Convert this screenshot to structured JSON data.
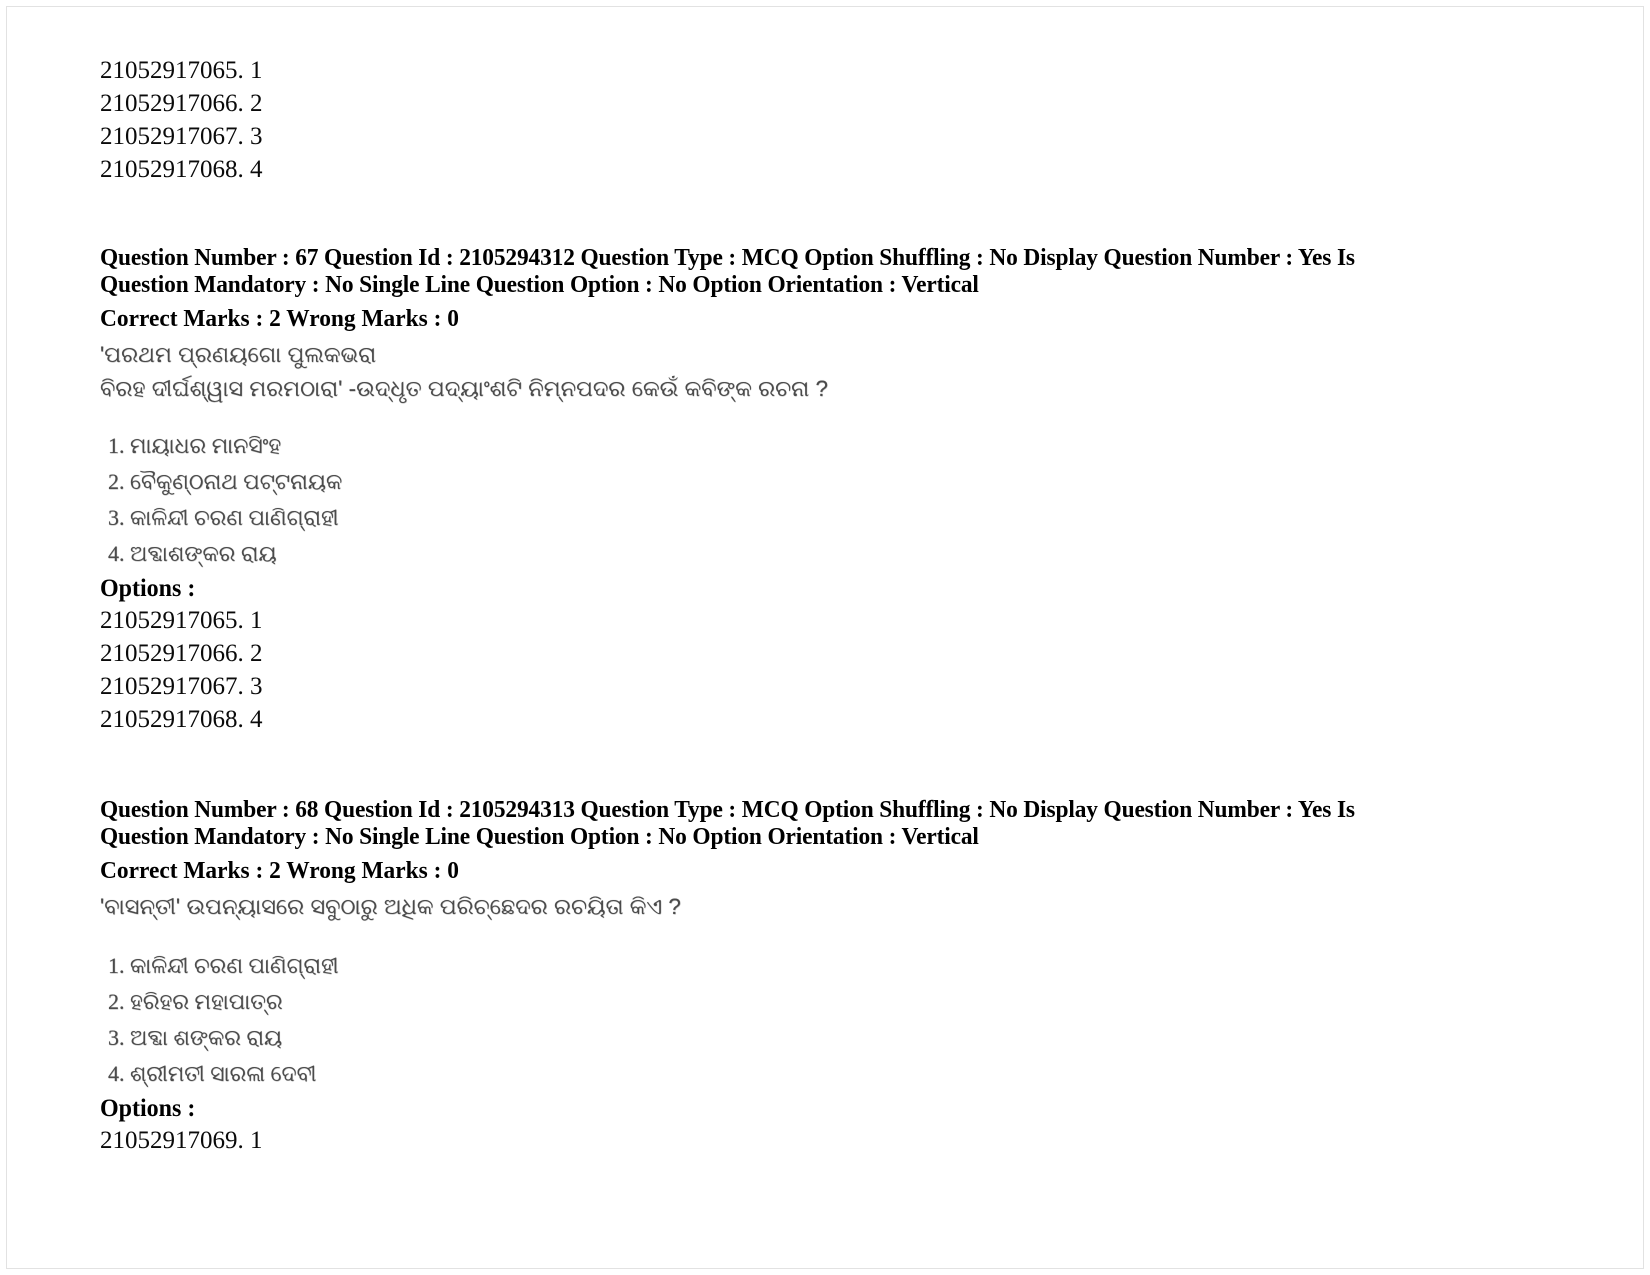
{
  "document": {
    "type": "exam-question-paper",
    "script_language": "Odia",
    "page_background": "#ffffff",
    "text_color": "#000000",
    "odia_text_color": "#4b4b4b"
  },
  "top_options": {
    "items": [
      {
        "id": "21052917065.",
        "value": "1"
      },
      {
        "id": "21052917066.",
        "value": "2"
      },
      {
        "id": "21052917067.",
        "value": "3"
      },
      {
        "id": "21052917068.",
        "value": "4"
      }
    ]
  },
  "questions": [
    {
      "header_line_1": "Question Number : 67 Question Id : 2105294312 Question Type : MCQ Option Shuffling : No Display Question Number : Yes Is",
      "header_line_2": "Question Mandatory : No Single Line Question Option : No Option Orientation : Vertical",
      "marks_line": "Correct Marks : 2 Wrong Marks : 0",
      "question_text_line_1": "'ପରଥମ ପ୍ରଣୟଗୋ ପୁଲକଭରା",
      "question_text_line_2": "ବିରହ ଦୀର୍ଘଶ୍ୱାସ ମରମଠାରା' -ଉଦ୍ଧୃତ ପଦ୍ୟାଂଶଟି ନିମ୍ନପଦର କେଉଁ କବିଙ୍କ ରଚନା ?",
      "choices": [
        {
          "num": "1.",
          "text": "ମାୟାଧର ମାନସିଂହ"
        },
        {
          "num": "2.",
          "text": "ବୈକୁଣ୍ଠନାଥ ପଟ୍ଟନାୟକ"
        },
        {
          "num": "3.",
          "text": "କାଳିନ୍ଦୀ ଚରଣ ପାଣିଗ୍ରାହୀ"
        },
        {
          "num": "4.",
          "text": "ଅବ୍ଦାଶଙ୍କର ରାୟ"
        }
      ],
      "options_label": "Options :",
      "options": [
        {
          "id": "21052917065.",
          "value": "1"
        },
        {
          "id": "21052917066.",
          "value": "2"
        },
        {
          "id": "21052917067.",
          "value": "3"
        },
        {
          "id": "21052917068.",
          "value": "4"
        }
      ]
    },
    {
      "header_line_1": "Question Number : 68 Question Id : 2105294313 Question Type : MCQ Option Shuffling : No Display Question Number : Yes Is",
      "header_line_2": "Question Mandatory : No Single Line Question Option : No Option Orientation : Vertical",
      "marks_line": "Correct Marks : 2 Wrong Marks : 0",
      "question_text_line_1": "'ବାସନ୍ତୀ' ଉପନ୍ୟାସରେ ସବୁଠାରୁ ଅଧିକ ପରିଚ୍ଛେଦର ରଚୟିତା କିଏ ?",
      "question_text_line_2": "",
      "choices": [
        {
          "num": "1.",
          "text": "କାଳିନ୍ଦୀ ଚରଣ ପାଣିଗ୍ରାହୀ"
        },
        {
          "num": "2.",
          "text": "ହରିହର ମହାପାତ୍ର"
        },
        {
          "num": "3.",
          "text": "ଅବ୍ଦା ଶଙ୍କର ରାୟ"
        },
        {
          "num": "4.",
          "text": "ଶ୍ରୀମତୀ ସାରଳା ଦେବୀ"
        }
      ],
      "options_label": "Options :",
      "options": [
        {
          "id": "21052917069.",
          "value": "1"
        }
      ]
    }
  ]
}
